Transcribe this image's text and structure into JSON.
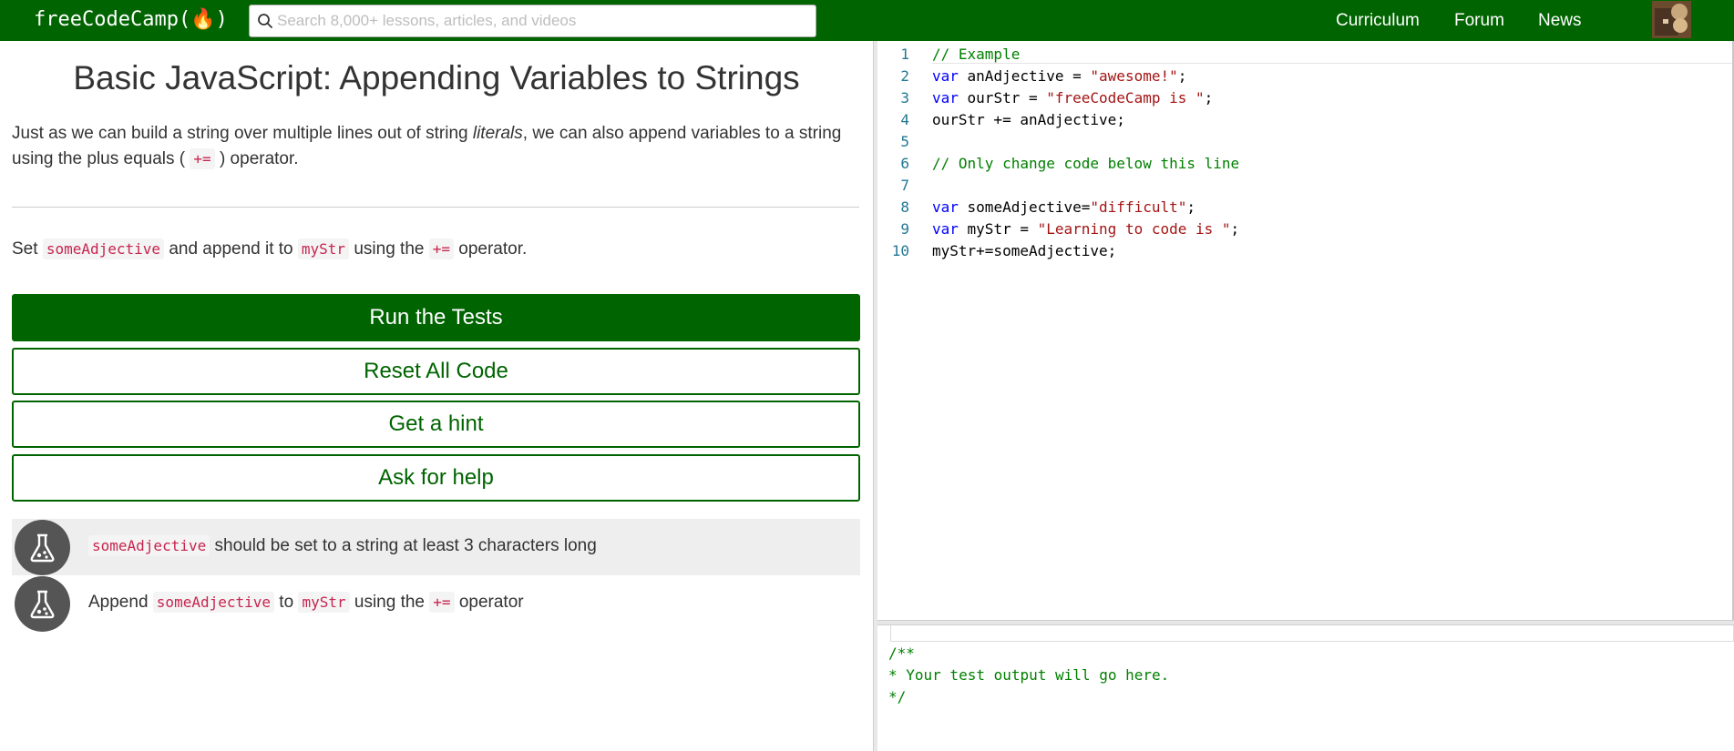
{
  "nav": {
    "logo": "freeCodeCamp(🔥)",
    "search_placeholder": "Search 8,000+ lessons, articles, and videos",
    "links": [
      "Curriculum",
      "Forum",
      "News"
    ],
    "colors": {
      "brand": "#006400"
    }
  },
  "challenge": {
    "title": "Basic JavaScript: Appending Variables to Strings",
    "desc_part1": "Just as we can build a string over multiple lines out of string ",
    "desc_literal": "literals",
    "desc_part2": ", we can also append variables to a string using the plus equals ( ",
    "desc_operator": "+=",
    "desc_part3": " ) operator.",
    "instr_part1": "Set ",
    "instr_var1": "someAdjective",
    "instr_part2": " and append it to ",
    "instr_var2": "myStr",
    "instr_part3": " using the ",
    "instr_operator": "+=",
    "instr_part4": " operator."
  },
  "buttons": {
    "run": "Run the Tests",
    "reset": "Reset All Code",
    "hint": "Get a hint",
    "help": "Ask for help"
  },
  "tests": [
    {
      "code": "someAdjective",
      "text": " should be set to a string at least 3 characters long"
    },
    {
      "pre": "Append ",
      "code1": "someAdjective",
      "mid": " to ",
      "code2": "myStr",
      "mid2": " using the ",
      "code3": "+=",
      "post": " operator"
    }
  ],
  "editor": {
    "lines": [
      {
        "n": "1",
        "parts": [
          [
            "comment",
            "// Example"
          ]
        ]
      },
      {
        "n": "2",
        "parts": [
          [
            "kw",
            "var"
          ],
          [
            "plain",
            " anAdjective = "
          ],
          [
            "str",
            "\"awesome!\""
          ],
          [
            "plain",
            ";"
          ]
        ]
      },
      {
        "n": "3",
        "parts": [
          [
            "kw",
            "var"
          ],
          [
            "plain",
            " ourStr = "
          ],
          [
            "str",
            "\"freeCodeCamp is \""
          ],
          [
            "plain",
            ";"
          ]
        ]
      },
      {
        "n": "4",
        "parts": [
          [
            "plain",
            "ourStr += anAdjective;"
          ]
        ]
      },
      {
        "n": "5",
        "parts": []
      },
      {
        "n": "6",
        "parts": [
          [
            "comment",
            "// Only change code below this line"
          ]
        ]
      },
      {
        "n": "7",
        "parts": []
      },
      {
        "n": "8",
        "parts": [
          [
            "kw",
            "var"
          ],
          [
            "plain",
            " someAdjective="
          ],
          [
            "str",
            "\"difficult\""
          ],
          [
            "plain",
            ";"
          ]
        ]
      },
      {
        "n": "9",
        "parts": [
          [
            "kw",
            "var"
          ],
          [
            "plain",
            " myStr = "
          ],
          [
            "str",
            "\"Learning to code is \""
          ],
          [
            "plain",
            ";"
          ]
        ]
      },
      {
        "n": "10",
        "parts": [
          [
            "plain",
            "myStr+=someAdjective;"
          ]
        ]
      }
    ]
  },
  "output": {
    "lines": [
      "/**",
      "* Your test output will go here.",
      "*/"
    ]
  }
}
